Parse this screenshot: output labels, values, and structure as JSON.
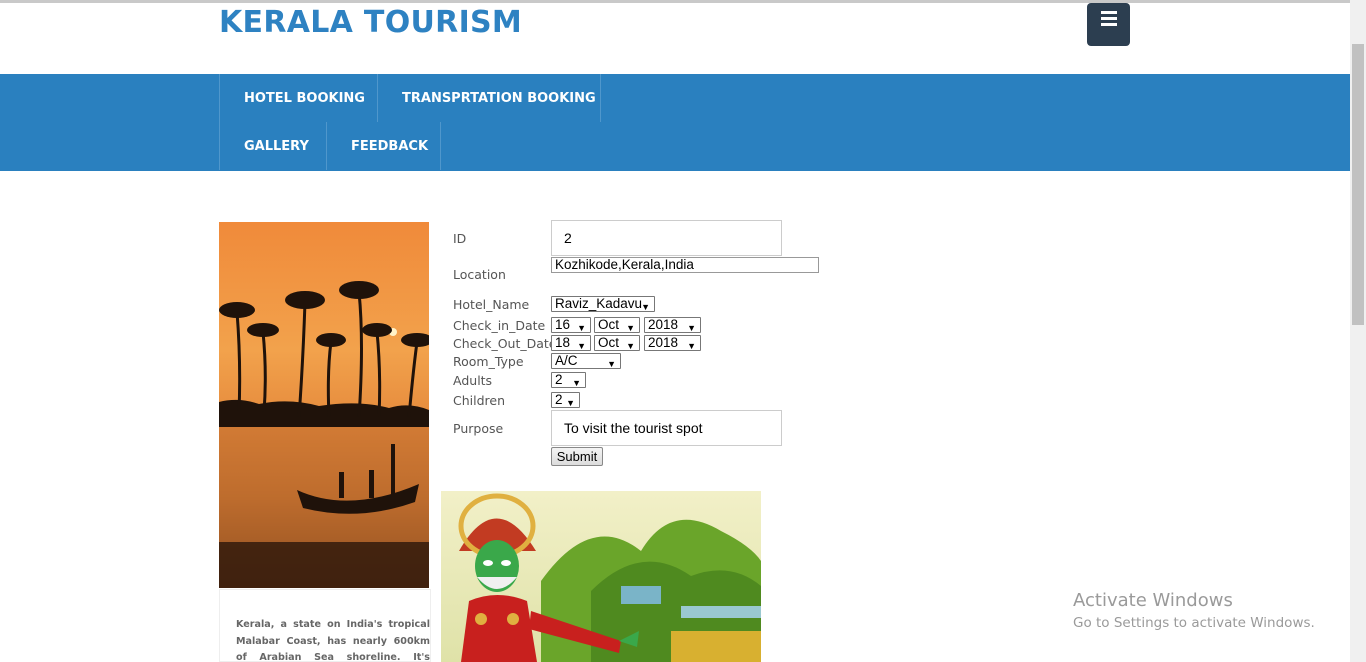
{
  "header": {
    "title": "KERALA TOURISM",
    "menu_icon": "hamburger-menu-icon"
  },
  "nav": {
    "items": [
      {
        "label": "HOTEL BOOKING"
      },
      {
        "label": "TRANSPRTATION BOOKING"
      },
      {
        "label": "GALLERY"
      },
      {
        "label": "FEEDBACK"
      }
    ]
  },
  "sidebar": {
    "text": "Kerala, a state on India's tropical Malabar Coast, has nearly 600km of Arabian Sea shoreline. It's known for"
  },
  "form": {
    "id_label": "ID",
    "id_value": "2",
    "location_label": "Location",
    "location_value": "Kozhikode,Kerala,India",
    "hotel_label": "Hotel_Name",
    "hotel_value": "Raviz_Kadavu",
    "checkin_label": "Check_in_Date",
    "checkin_day": "16",
    "checkin_month": "Oct",
    "checkin_year": "2018",
    "checkout_label": "Check_Out_Date",
    "checkout_day": "18",
    "checkout_month": "Oct",
    "checkout_year": "2018",
    "room_label": "Room_Type",
    "room_value": "A/C",
    "adults_label": "Adults",
    "adults_value": "2",
    "children_label": "Children",
    "children_value": "2",
    "purpose_label": "Purpose",
    "purpose_value": "To visit the tourist spot",
    "submit_label": "Submit",
    "dropdown_arrow": "▼"
  },
  "watermark": {
    "title": "Activate Windows",
    "subtitle": "Go to Settings to activate Windows."
  },
  "colors": {
    "brand": "#2e82c2",
    "navbar": "#2a80bf",
    "menu_button": "#2c3e50"
  }
}
